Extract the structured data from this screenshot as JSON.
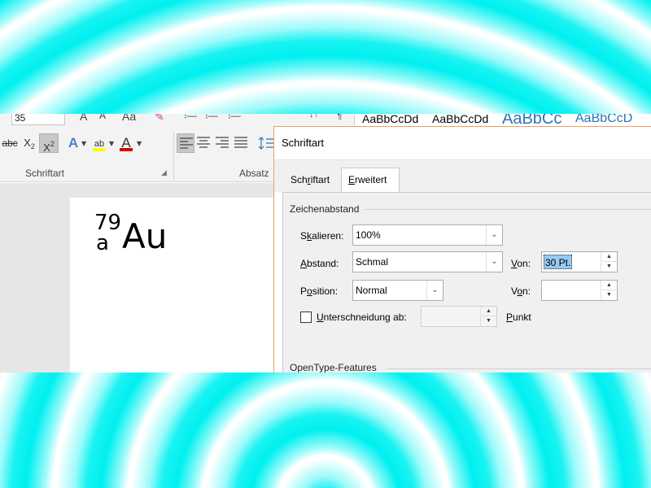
{
  "ribbon": {
    "font_size": "35",
    "styles": [
      "AaBbCcDd",
      "AaBbCcDd",
      "AaBbCc",
      "AaBbCcD"
    ],
    "group_font": "Schriftart",
    "group_paragraph": "Absatz",
    "format_buttons": {
      "strikethrough": "abc",
      "subscript_base": "X",
      "subscript_mark": "2",
      "superscript_base": "X",
      "superscript_mark": "2",
      "text_effects": "A",
      "highlight": "ab",
      "font_color": "A"
    }
  },
  "document": {
    "formula_sup": "79",
    "formula_sub": "a",
    "formula_symbol": "Au"
  },
  "dialog": {
    "title": "Schriftart",
    "tabs": [
      "Schriftart",
      "Erweitert"
    ],
    "active_tab": "Erweitert",
    "section_spacing": "Zeichenabstand",
    "scale_label": "Skalieren:",
    "scale_value": "100%",
    "spacing_label": "Abstand:",
    "spacing_value": "Schmal",
    "spacing_by_label": "Von:",
    "spacing_by_value": "30 Pt.",
    "position_label": "Position:",
    "position_value": "Normal",
    "position_by_label": "Von:",
    "position_by_value": "",
    "kerning_label": "Unterschneidung ab:",
    "kerning_value": "",
    "kerning_unit": "Punkt",
    "section_opentype": "OpenType-Features"
  },
  "colors": {
    "highlight": "#ffff00",
    "font_color": "#e00000",
    "dialog_border": "#f0a060",
    "selection": "#99c9ef"
  }
}
